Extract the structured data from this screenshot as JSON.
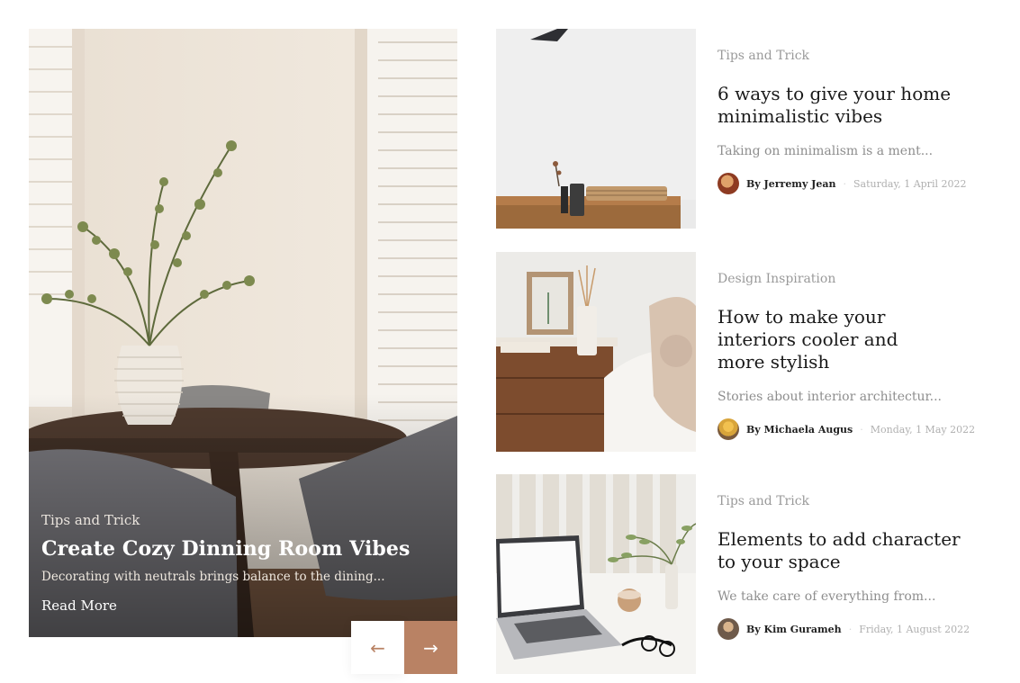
{
  "hero": {
    "category": "Tips and Trick",
    "title": "Create Cozy Dinning Room Vibes",
    "excerpt": "Decorating with neutrals brings balance to the dining...",
    "read_more": "Read More",
    "prev_icon": "arrow-left-icon",
    "next_icon": "arrow-right-icon",
    "prev_glyph": "←",
    "next_glyph": "→",
    "accent_color": "#b98264"
  },
  "articles": [
    {
      "category": "Tips and Trick",
      "title": "6 ways to give your home minimalistic vibes",
      "excerpt": "Taking on minimalism is a ment...",
      "author": "By Jerremy Jean",
      "separator": "·",
      "date": "Saturday, 1 April 2022"
    },
    {
      "category": "Design Inspiration",
      "title": "How to make your interiors cooler and more stylish",
      "excerpt": "Stories about interior architectur...",
      "author": "By Michaela Augus",
      "separator": "·",
      "date": "Monday, 1 May 2022"
    },
    {
      "category": "Tips and Trick",
      "title": "Elements to add character to your space",
      "excerpt": "We take care of everything from...",
      "author": "By Kim Gurameh",
      "separator": "·",
      "date": "Friday, 1 August 2022"
    }
  ]
}
